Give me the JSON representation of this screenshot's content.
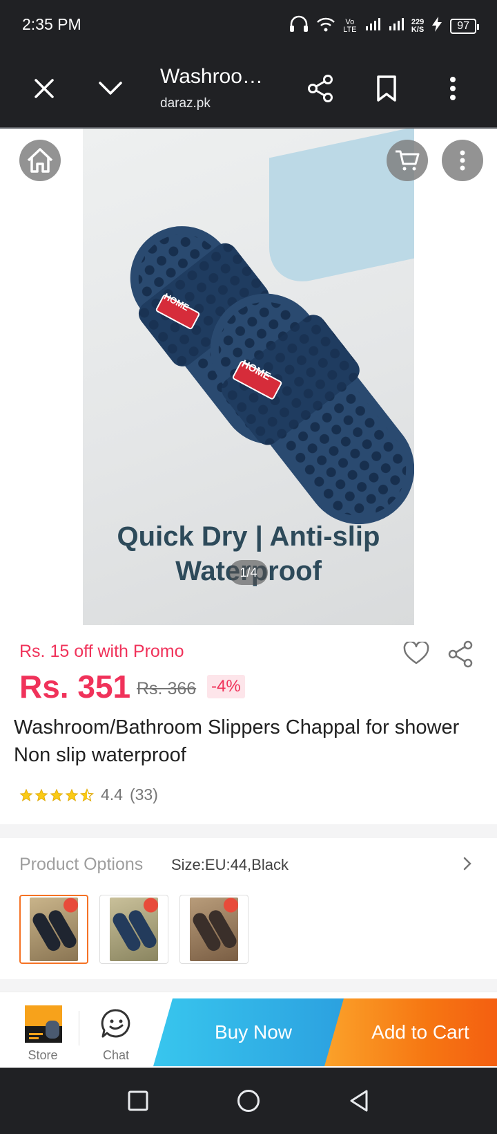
{
  "status_bar": {
    "time": "2:35 PM",
    "net_speed": "229",
    "net_unit": "K/S",
    "battery": "97",
    "volte": "Vo LTE"
  },
  "toolbar": {
    "title": "Washroo…",
    "domain": "daraz.pk"
  },
  "gallery": {
    "promo_line1": "Quick Dry | Anti-slip",
    "promo_line2": "Waterproof",
    "badge_text": "HOME",
    "counter": "1/4"
  },
  "product": {
    "promo": "Rs. 15 off with Promo",
    "price": "Rs. 351",
    "old_price": "Rs. 366",
    "discount": "-4%",
    "title": "Washroom/Bathroom Slippers Chappal for shower Non slip waterproof",
    "rating": "4.4",
    "rating_count": "(33)",
    "stars_value": 4.4
  },
  "options": {
    "label": "Product Options",
    "value": "Size:EU:44,Black"
  },
  "action_bar": {
    "store_label": "Store",
    "chat_label": "Chat",
    "buy_now": "Buy Now",
    "add_to_cart": "Add to Cart"
  },
  "colors": {
    "accent_red": "#f0325a",
    "buy_blue": "#2b9fdf",
    "cart_orange": "#f67612"
  }
}
